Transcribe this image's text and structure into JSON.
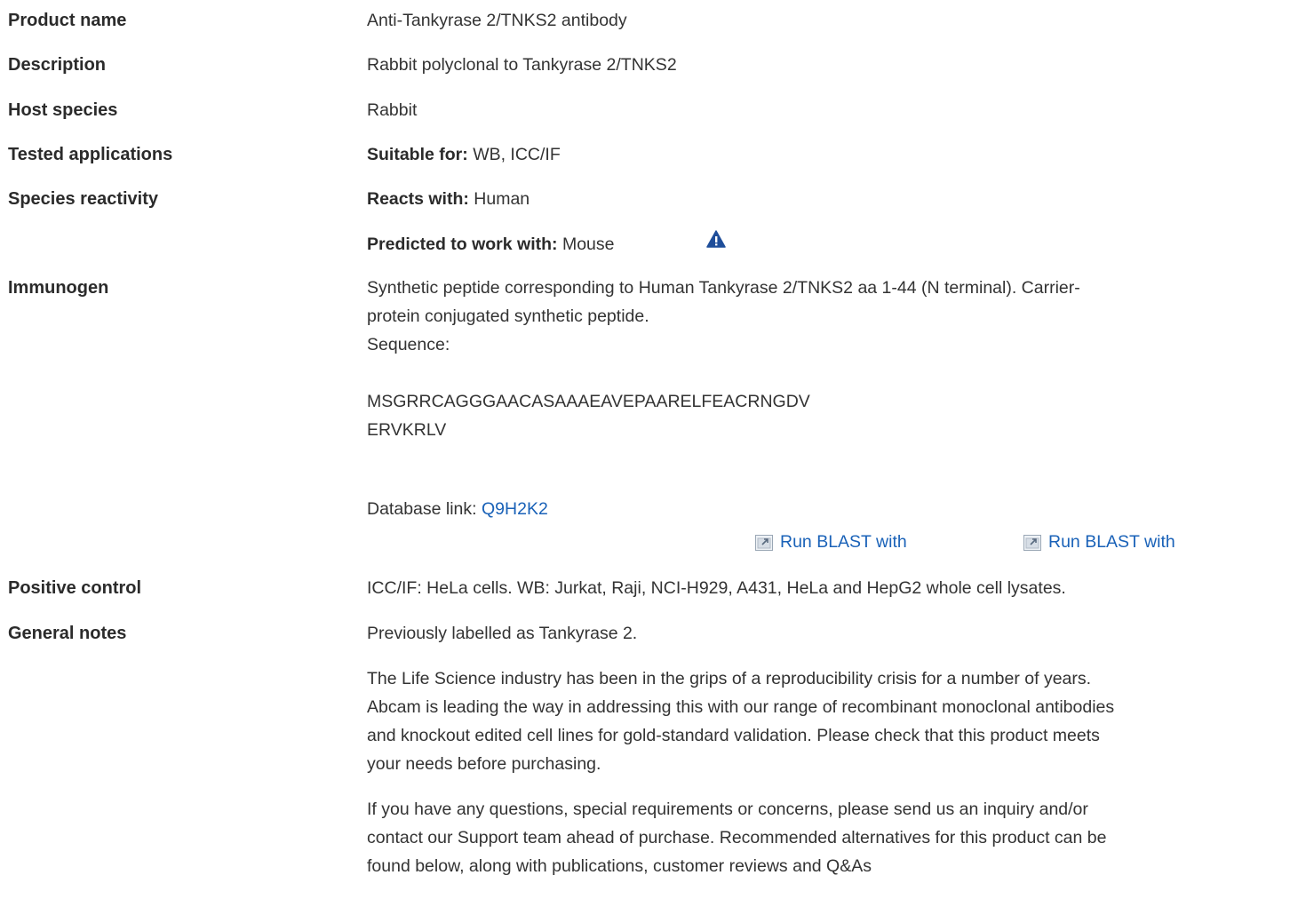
{
  "rows": {
    "product_name": {
      "label": "Product name",
      "value": "Anti-Tankyrase 2/TNKS2 antibody"
    },
    "description": {
      "label": "Description",
      "value": "Rabbit polyclonal to Tankyrase 2/TNKS2"
    },
    "host_species": {
      "label": "Host species",
      "value": "Rabbit"
    },
    "tested_applications": {
      "label": "Tested applications",
      "prefix": "Suitable for:",
      "value": "WB, ICC/IF"
    },
    "species_reactivity": {
      "label": "Species reactivity",
      "reacts_prefix": "Reacts with:",
      "reacts_value": "Human",
      "predicted_prefix": "Predicted to work with:",
      "predicted_value": "Mouse",
      "warning_icon": "warning-triangle-icon"
    },
    "immunogen": {
      "label": "Immunogen",
      "line1": "Synthetic peptide corresponding to Human Tankyrase 2/TNKS2 aa 1-44 (N terminal). Carrier-",
      "line2": "protein conjugated synthetic peptide.",
      "sequence_label": "Sequence:",
      "sequence_line1": "MSGRRCAGGGAACASAAAEAVEPAARELFEACRNGDV",
      "sequence_line2": "ERVKRLV",
      "db_prefix": "Database link:",
      "db_link": "Q9H2K2",
      "blast1": "Run BLAST with",
      "blast2": "Run BLAST with"
    },
    "positive_control": {
      "label": "Positive control",
      "value": "ICC/IF: HeLa cells. WB: Jurkat, Raji, NCI-H929, A431, HeLa and HepG2 whole cell lysates."
    },
    "general_notes": {
      "label": "General notes",
      "p1": "Previously labelled as Tankyrase 2.",
      "p2_l1": "The Life Science industry has been in the grips of a reproducibility crisis for a number of years.",
      "p2_l2": "Abcam is leading the way in addressing this with our range of recombinant monoclonal antibodies",
      "p2_l3": "and knockout edited cell lines for gold-standard validation. Please check that this product meets",
      "p2_l4": "your needs before purchasing.",
      "p3_l1": "If you have any questions, special requirements or concerns, please send us an inquiry and/or",
      "p3_l2": "contact our Support team ahead of purchase. Recommended alternatives for this product can be",
      "p3_l3": "found below, along with publications, customer reviews and Q&As"
    }
  },
  "colors": {
    "link": "#1a62b8",
    "warning": "#1f4e9a",
    "text": "#333333"
  }
}
